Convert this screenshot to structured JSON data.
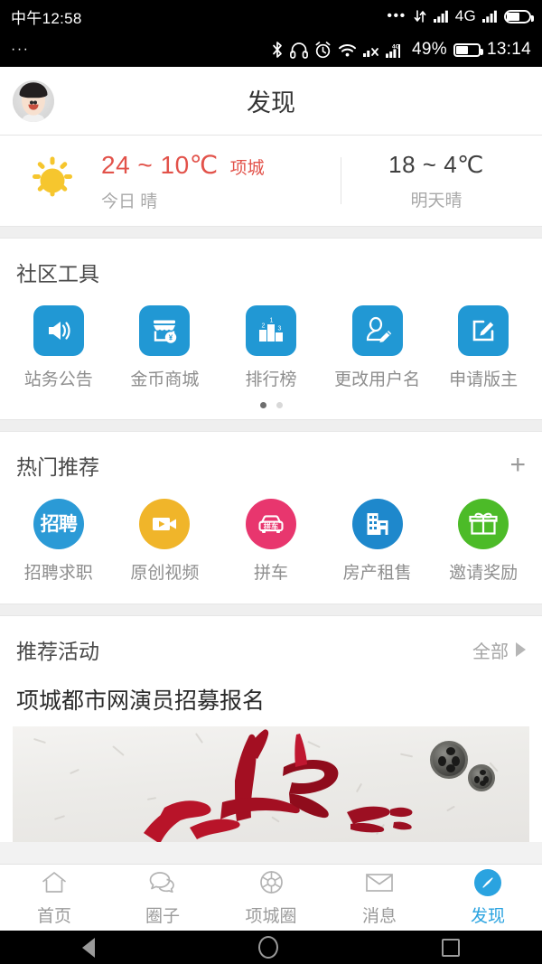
{
  "status_bar_top": {
    "time": "中午12:58",
    "icons": [
      "overflow-dots-icon",
      "data-transfer-icon",
      "signal-bars-icon",
      "network-4g-icon",
      "signal-bars-icon",
      "battery-icon"
    ],
    "network_label": "4G"
  },
  "status_bar_bottom": {
    "left_dots": "···",
    "icons": [
      "bluetooth-icon",
      "headphones-icon",
      "alarm-clock-icon",
      "wifi-icon",
      "no-signal-icon",
      "signal-4g-icon"
    ],
    "network_label": "4G",
    "battery_percent": "49%",
    "time": "13:14"
  },
  "header": {
    "title": "发现",
    "avatar_name": "user-avatar"
  },
  "weather": {
    "today_temp": "24 ~ 10℃",
    "city": "项城",
    "today_desc": "今日 晴",
    "tomorrow_temp": "18 ~ 4℃",
    "tomorrow_desc": "明天晴",
    "accent_color": "#e2524a",
    "sun_color": "#f6c62e"
  },
  "community_tools": {
    "title": "社区工具",
    "icon_color": "#2198d4",
    "items": [
      {
        "label": "站务公告",
        "icon": "speaker-announcement-icon"
      },
      {
        "label": "金币商城",
        "icon": "shop-coin-icon"
      },
      {
        "label": "排行榜",
        "icon": "ranking-podium-icon"
      },
      {
        "label": "更改用户名",
        "icon": "user-edit-icon"
      },
      {
        "label": "申请版主",
        "icon": "edit-square-icon"
      }
    ],
    "page_dots": {
      "count": 2,
      "active": 0
    }
  },
  "hot_recommend": {
    "title": "热门推荐",
    "add_label": "+",
    "items": [
      {
        "label": "招聘求职",
        "icon": "recruitment-icon",
        "color": "#2b9ad6",
        "glyph": "招聘"
      },
      {
        "label": "原创视频",
        "icon": "video-camera-icon",
        "color": "#f0b52a",
        "glyph": ""
      },
      {
        "label": "拼车",
        "icon": "carpool-icon",
        "color": "#e8366e",
        "glyph": "拼车"
      },
      {
        "label": "房产租售",
        "icon": "building-icon",
        "color": "#1e88cc",
        "glyph": ""
      },
      {
        "label": "邀请奖励",
        "icon": "gift-icon",
        "color": "#4cbb28",
        "glyph": ""
      }
    ]
  },
  "recommend_activity": {
    "title": "推荐活动",
    "all_label": "全部",
    "arrow_icon": "chevron-right-icon",
    "featured_title": "项城都市网演员招募报名",
    "banner_alt": "red-brush-calligraphy-film-reel-banner"
  },
  "tabbar": {
    "active_index": 4,
    "active_color": "#2aa3e0",
    "items": [
      {
        "label": "首页",
        "icon": "home-icon"
      },
      {
        "label": "圈子",
        "icon": "chat-bubbles-icon"
      },
      {
        "label": "项城圈",
        "icon": "aperture-icon"
      },
      {
        "label": "消息",
        "icon": "envelope-icon"
      },
      {
        "label": "发现",
        "icon": "compass-discover-icon"
      }
    ]
  },
  "android_nav": {
    "items": [
      {
        "icon": "android-back-icon"
      },
      {
        "icon": "android-home-icon"
      },
      {
        "icon": "android-recents-icon"
      }
    ]
  }
}
